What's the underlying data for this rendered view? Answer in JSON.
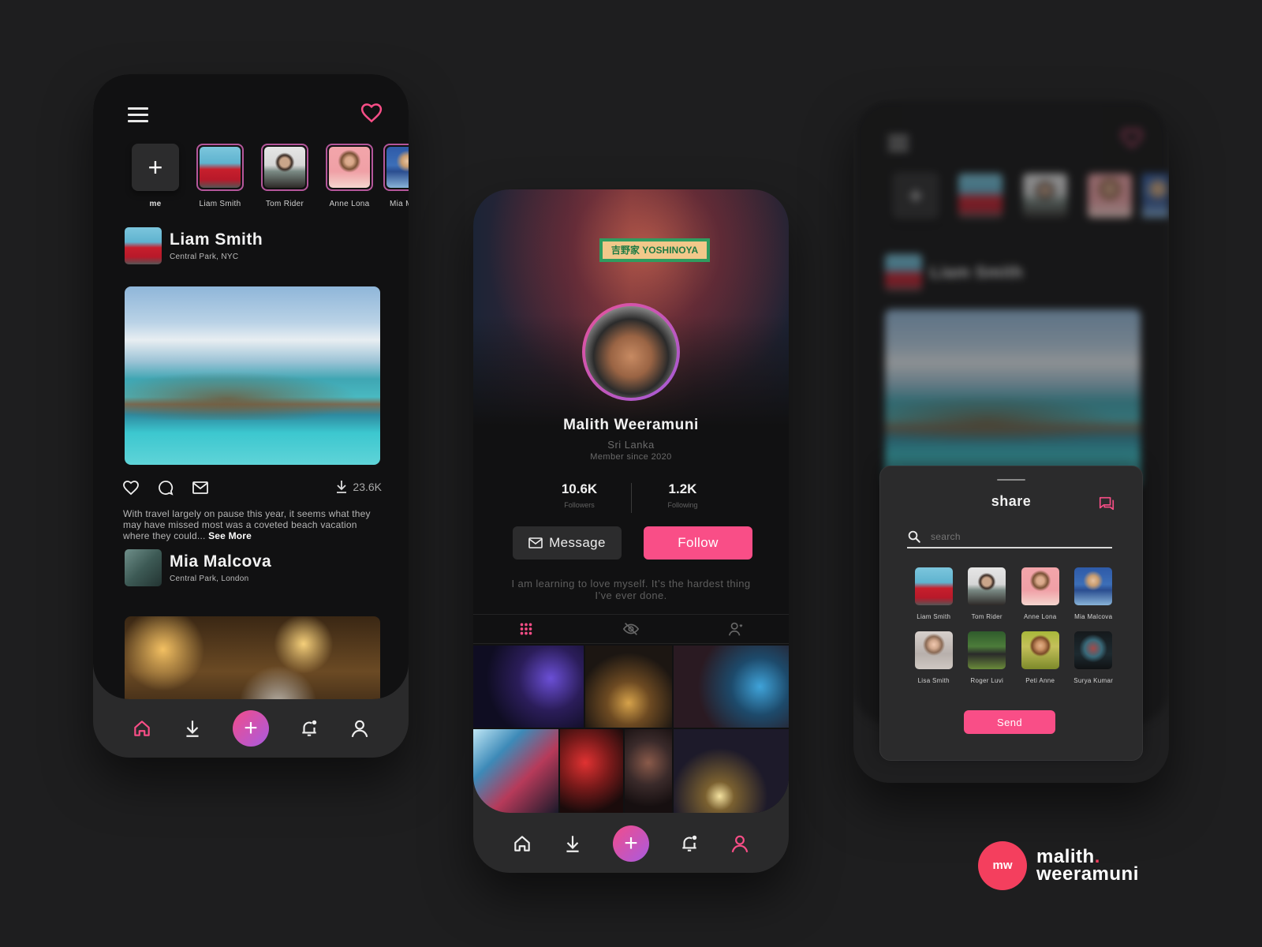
{
  "brand": {
    "logo_mark": "mw",
    "name_line1": "malith",
    "name_dot": ".",
    "name_line2": "weeramuni",
    "accent": "#f94e87",
    "gradient_start": "#f24c8a",
    "gradient_end": "#a85be0"
  },
  "feed": {
    "stories": [
      {
        "label": "me",
        "add_icon": "+"
      },
      {
        "label": "Liam Smith"
      },
      {
        "label": "Tom Rider"
      },
      {
        "label": "Anne Lona"
      },
      {
        "label": "Mia M"
      }
    ],
    "posts": [
      {
        "author": "Liam Smith",
        "location": "Central Park, NYC",
        "image": "tropical-beach-resort",
        "download_count": "23.6K",
        "caption": "With travel largely on pause this year, it seems what they may have missed most was a coveted beach vacation where they could...",
        "see_more": "See More"
      },
      {
        "author": "Mia Malcova",
        "location": "Central Park, London",
        "image": "festive-gathering"
      }
    ],
    "nav": {
      "active": "home",
      "plus": "+"
    }
  },
  "profile": {
    "name": "Malith Weeramuni",
    "location": "Sri Lanka",
    "member_since": "Member since 2020",
    "stats": [
      {
        "value": "10.6K",
        "label": "Followers"
      },
      {
        "value": "1.2K",
        "label": "Following"
      }
    ],
    "message_button": "Message",
    "follow_button": "Follow",
    "bio": "I am learning to love myself. It’s the hardest thing I’ve ever done.",
    "cover_sign": "吉野家 YOSHINOYA",
    "tabs": [
      "grid",
      "hidden",
      "tagged"
    ],
    "active_tab": "grid",
    "nav": {
      "active": "profile",
      "plus": "+"
    }
  },
  "share": {
    "title": "share",
    "search_placeholder": "search",
    "contacts": [
      {
        "name": "Liam Smith"
      },
      {
        "name": "Tom Rider"
      },
      {
        "name": "Anne Lona"
      },
      {
        "name": "Mia Malcova"
      },
      {
        "name": "Lisa Smith"
      },
      {
        "name": "Roger Luvi"
      },
      {
        "name": "Peti Anne"
      },
      {
        "name": "Surya Kumar"
      }
    ],
    "send_button": "Send",
    "background_blurred": {
      "author": "Liam Smith"
    }
  }
}
